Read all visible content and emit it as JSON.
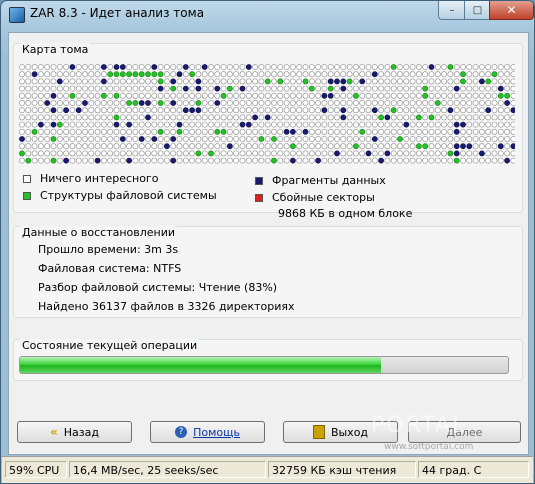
{
  "window": {
    "title": "ZAR 8.3 - Идет анализ тома",
    "min": "–",
    "max": "□",
    "close": "✕"
  },
  "map": {
    "title": "Карта тома",
    "cols": 79,
    "rows": 14,
    "colors": {
      "empty": "#ffffff",
      "fs": "#22c322",
      "data": "#1a1a6e",
      "bad": "#e02020"
    },
    "legend": {
      "empty": "Ничего интересного",
      "fs": "Структуры файловой системы",
      "data": "Фрагменты данных",
      "bad": "Сбойные секторы",
      "block_info": "9868 КБ в одном блоке"
    }
  },
  "recovery": {
    "title": "Данные о восстановлении",
    "elapsed": "Прошло времени: 3m 3s",
    "fs": "Файловая система: NTFS",
    "parse": "Разбор файловой системы: Чтение (83%)",
    "found": "Найдено 36137 файлов в 3326 директориях"
  },
  "operation": {
    "title": "Состояние текущей операции",
    "progress": 0.74
  },
  "buttons": {
    "back": "Назад",
    "help": "Помощь",
    "exit": "Выход",
    "next": "Далее"
  },
  "statusbar": {
    "cpu": "59% CPU",
    "speed": "16,4 MB/sec, 25 seeks/sec",
    "cache": "32759 КБ кэш чтения",
    "temp": "44 град. С"
  },
  "watermark": {
    "brand": "PORTAL",
    "site": "www.softportal.com"
  }
}
